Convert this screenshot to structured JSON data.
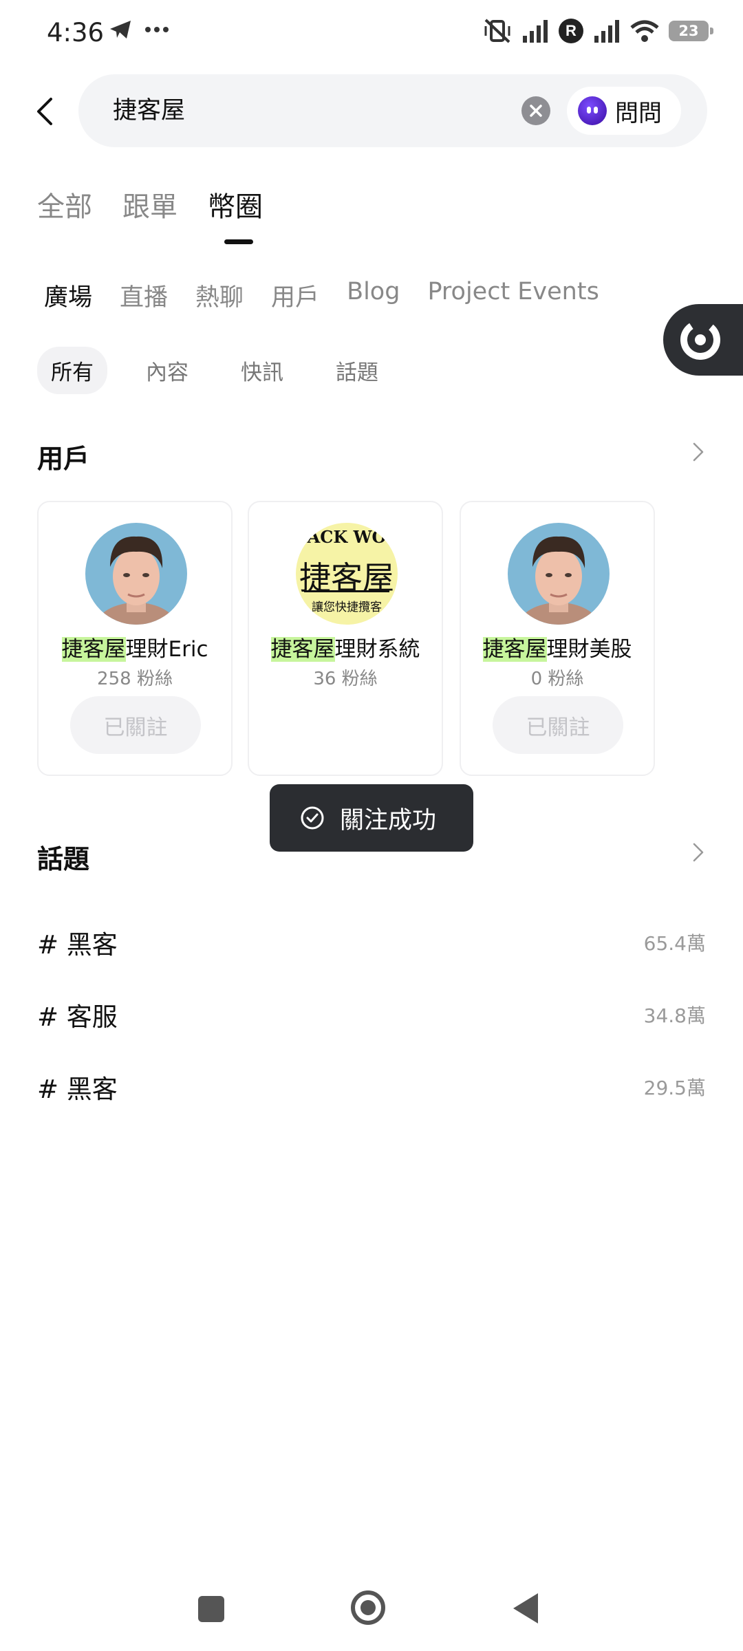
{
  "status_bar": {
    "time": "4:36",
    "battery": "23"
  },
  "search": {
    "query": "捷客屋",
    "ask_label": "問問"
  },
  "main_tabs": [
    {
      "label": "全部"
    },
    {
      "label": "跟單"
    },
    {
      "label": "幣圈"
    }
  ],
  "sub_tabs": [
    {
      "label": "廣場"
    },
    {
      "label": "直播"
    },
    {
      "label": "熱聊"
    },
    {
      "label": "用戶"
    },
    {
      "label": "Blog"
    },
    {
      "label": "Project Events"
    }
  ],
  "filter_chips": [
    {
      "label": "所有"
    },
    {
      "label": "內容"
    },
    {
      "label": "快訊"
    },
    {
      "label": "話題"
    }
  ],
  "users_section": {
    "title": "用戶",
    "cards": [
      {
        "name_highlight": "捷客屋",
        "name_rest": "理財Eric",
        "fans": "258 粉絲",
        "follow_label": "已關註"
      },
      {
        "name_highlight": "捷客屋",
        "name_rest": "理財系統",
        "fans": "36 粉絲",
        "avatar_top_text": "ACK WO",
        "avatar_main_text": "捷客屋",
        "avatar_bottom_text": "讓您快捷攬客"
      },
      {
        "name_highlight": "捷客屋",
        "name_rest": "理財美股",
        "fans": "0 粉絲",
        "follow_label": "已關註"
      }
    ]
  },
  "toast": {
    "text": "關注成功"
  },
  "topics_section": {
    "title": "話題",
    "items": [
      {
        "name": "# 黑客",
        "count": "65.4萬"
      },
      {
        "name": "# 客服",
        "count": "34.8萬"
      },
      {
        "name": "# 黑客",
        "count": "29.5萬"
      }
    ]
  }
}
